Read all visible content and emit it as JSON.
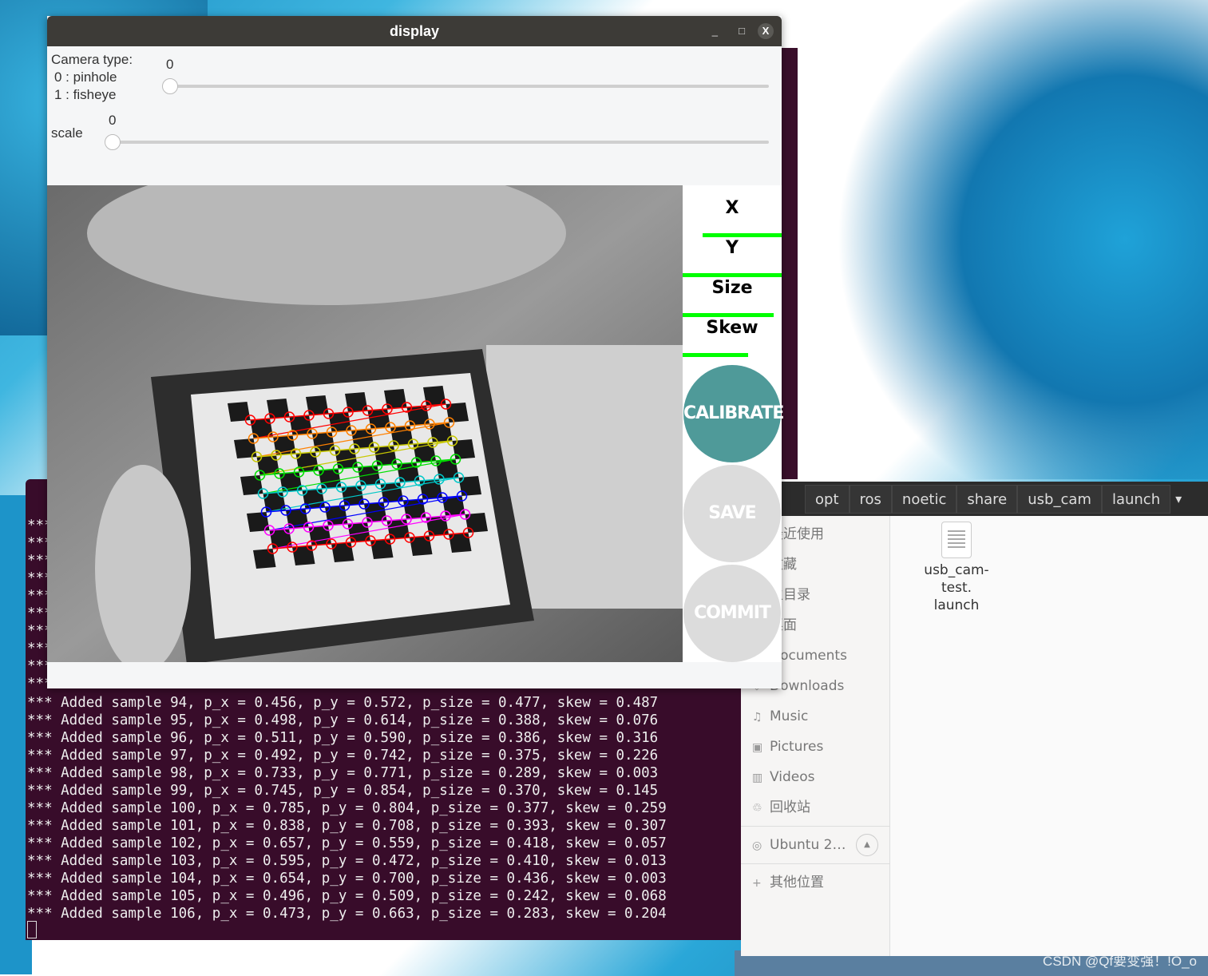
{
  "display_window": {
    "title": "display",
    "minimize": "_",
    "maximize": "□",
    "close": "X",
    "camera_type": {
      "label_line1": "Camera type:",
      "label_line2": "0 : pinhole",
      "label_line3": "1 : fisheye",
      "value": "0",
      "slider_fraction": 0
    },
    "scale": {
      "label": "scale",
      "value": "0",
      "slider_fraction": 0
    },
    "progress": [
      {
        "label": "X",
        "fraction": 0.8,
        "color": "#00ff00"
      },
      {
        "label": "Y",
        "fraction": 1.0,
        "color": "#00ff00"
      },
      {
        "label": "Size",
        "fraction": 0.92,
        "color": "#00ff00"
      },
      {
        "label": "Skew",
        "fraction": 0.66,
        "color": "#00ff00"
      }
    ],
    "buttons": {
      "calibrate": "CALIBRATE",
      "save": "SAVE",
      "commit": "COMMIT"
    },
    "colors": {
      "calibrate": "#4f9a99",
      "disabled": "#dcdcdc"
    }
  },
  "terminal": {
    "hidden_prefix": "***",
    "lines": [
      "*** Added sample 94, p_x = 0.456, p_y = 0.572, p_size = 0.477, skew = 0.487",
      "*** Added sample 95, p_x = 0.498, p_y = 0.614, p_size = 0.388, skew = 0.076",
      "*** Added sample 96, p_x = 0.511, p_y = 0.590, p_size = 0.386, skew = 0.316",
      "*** Added sample 97, p_x = 0.492, p_y = 0.742, p_size = 0.375, skew = 0.226",
      "*** Added sample 98, p_x = 0.733, p_y = 0.771, p_size = 0.289, skew = 0.003",
      "*** Added sample 99, p_x = 0.745, p_y = 0.854, p_size = 0.370, skew = 0.145",
      "*** Added sample 100, p_x = 0.785, p_y = 0.804, p_size = 0.377, skew = 0.259",
      "*** Added sample 101, p_x = 0.838, p_y = 0.708, p_size = 0.393, skew = 0.307",
      "*** Added sample 102, p_x = 0.657, p_y = 0.559, p_size = 0.418, skew = 0.057",
      "*** Added sample 103, p_x = 0.595, p_y = 0.472, p_size = 0.410, skew = 0.013",
      "*** Added sample 104, p_x = 0.654, p_y = 0.700, p_size = 0.436, skew = 0.003",
      "*** Added sample 105, p_x = 0.496, p_y = 0.509, p_size = 0.242, skew = 0.068",
      "*** Added sample 106, p_x = 0.473, p_y = 0.663, p_size = 0.283, skew = 0.204"
    ]
  },
  "file_manager": {
    "breadcrumbs": [
      "opt",
      "ros",
      "noetic",
      "share",
      "usb_cam",
      "launch"
    ],
    "sidebar": [
      {
        "label": "最近使用",
        "icon": "clock-icon"
      },
      {
        "label": "收藏",
        "icon": "star-icon"
      },
      {
        "label": "主目录",
        "icon": "home-icon"
      },
      {
        "label": "桌面",
        "icon": "desktop-icon"
      },
      {
        "label": "Documents",
        "icon": "document-icon"
      },
      {
        "label": "Downloads",
        "icon": "download-icon"
      },
      {
        "label": "Music",
        "icon": "music-icon"
      },
      {
        "label": "Pictures",
        "icon": "picture-icon"
      },
      {
        "label": "Videos",
        "icon": "video-icon"
      },
      {
        "label": "回收站",
        "icon": "trash-icon"
      }
    ],
    "drive": {
      "label": "Ubuntu 2…",
      "icon": "disc-icon",
      "eject": "▲"
    },
    "other": {
      "label": "其他位置",
      "icon": "plus-icon"
    },
    "files": [
      {
        "name_line1": "usb_cam-",
        "name_line2": "test.",
        "name_line3": "launch"
      }
    ]
  },
  "watermark": "CSDN @Qf要变强！!O_o"
}
